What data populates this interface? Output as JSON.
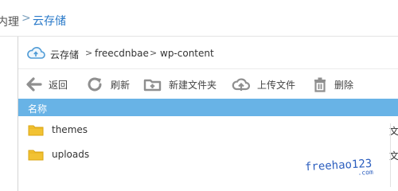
{
  "breadcrumb": {
    "previous": "内理",
    "separator": ">",
    "current": "云存储"
  },
  "path": {
    "root": "云存储",
    "separator": ">",
    "segments": [
      "freecdnbae",
      "wp-content"
    ]
  },
  "toolbar": {
    "back_label": "返回",
    "refresh_label": "刷新",
    "new_folder_label": "新建文件夹",
    "upload_label": "上传文件",
    "delete_label": "删除"
  },
  "list": {
    "header_name": "名称",
    "rows": [
      {
        "name": "themes",
        "type": "文"
      },
      {
        "name": "uploads",
        "type": "文"
      }
    ]
  },
  "watermark": {
    "text": "freehao123",
    "suffix": ".com"
  },
  "colors": {
    "header_bg": "#68b3e6",
    "folder": "#f2c233",
    "accent": "#2a7ac9"
  }
}
